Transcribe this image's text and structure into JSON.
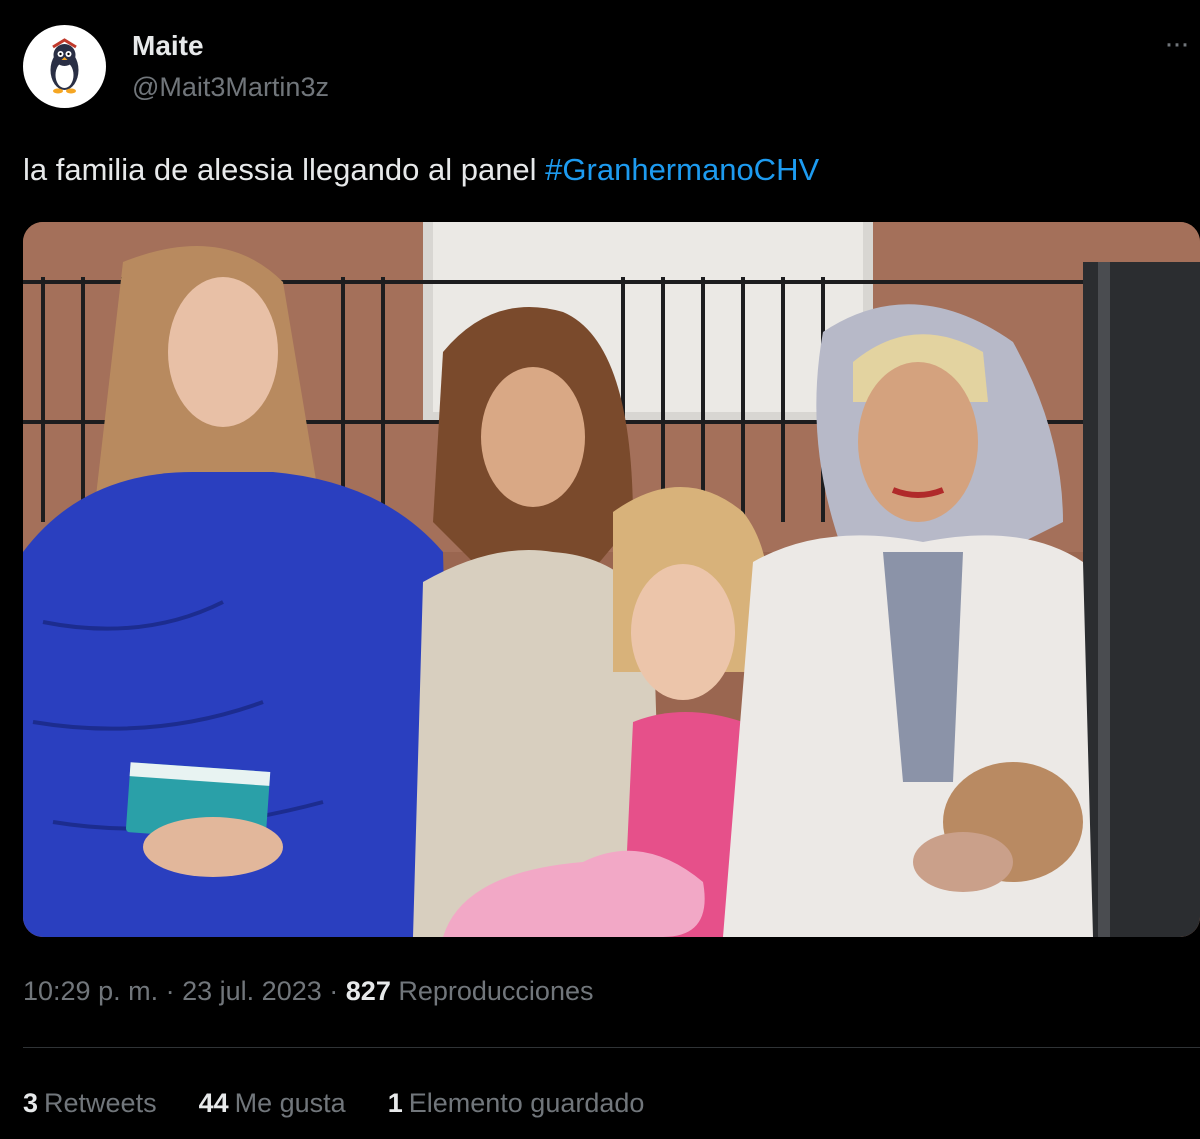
{
  "author": {
    "display_name": "Maite",
    "handle": "@Mait3Martin3z",
    "avatar_icon": "penguin-avatar-icon"
  },
  "more_icon": "more-options-icon",
  "tweet": {
    "text": "la familia de alessia llegando al panel ",
    "hashtag": "#GranhermanoCHV",
    "hashtag_color": "#1d9bf0"
  },
  "media": {
    "icon": "photo-image"
  },
  "meta": {
    "time": "10:29 p. m.",
    "separator": "·",
    "date": "23 jul. 2023",
    "views_count": "827",
    "views_label": "Reproducciones"
  },
  "stats": {
    "retweets_count": "3",
    "retweets_label": "Retweets",
    "likes_count": "44",
    "likes_label": "Me gusta",
    "bookmarks_count": "1",
    "bookmarks_label": "Elemento guardado"
  },
  "colors": {
    "background": "#000000",
    "text_primary": "#e7e9ea",
    "text_secondary": "#71767b",
    "divider": "#2f3336"
  }
}
